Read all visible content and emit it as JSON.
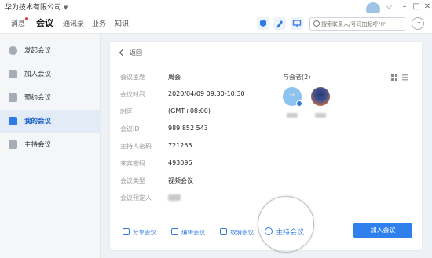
{
  "window": {
    "company": "华为技术有限公司",
    "avatar_text": "(blurred)"
  },
  "nav": {
    "tabs": [
      {
        "label": "消息",
        "active": false,
        "badge": true
      },
      {
        "label": "会议",
        "active": true
      },
      {
        "label": "通讯录",
        "active": false
      },
      {
        "label": "业务",
        "active": false
      },
      {
        "label": "知识",
        "active": false
      }
    ],
    "search_placeholder": "搜索联系人/号码加起呼\"0\""
  },
  "sidebar": {
    "items": [
      {
        "label": "发起会议",
        "icon": "phone-icon",
        "active": false
      },
      {
        "label": "加入会议",
        "icon": "join-icon",
        "active": false
      },
      {
        "label": "预约会议",
        "icon": "calendar-icon",
        "active": false
      },
      {
        "label": "我的会议",
        "icon": "my-meetings-icon",
        "active": true
      },
      {
        "label": "主持会议",
        "icon": "host-icon",
        "active": false
      }
    ]
  },
  "detail": {
    "back_label": "返回",
    "fields": [
      {
        "key": "会议主题",
        "value": "周会"
      },
      {
        "key": "会议时间",
        "value": "2020/04/09 09:30-10:30"
      },
      {
        "key": "时区",
        "value": "(GMT+08:00)"
      },
      {
        "key": "会议ID",
        "value": "989 852 543"
      },
      {
        "key": "主持人密码",
        "value": "721255"
      },
      {
        "key": "来宾密码",
        "value": "493096"
      },
      {
        "key": "会议类型",
        "value": "视频会议"
      },
      {
        "key": "会议预定人",
        "value": ""
      }
    ],
    "attendees_title": "与会者(2)"
  },
  "actions": {
    "share": "分享会议",
    "edit": "编辑会议",
    "cancel": "取消会议",
    "host": "主持会议",
    "join": "加入会议"
  },
  "colors": {
    "accent": "#2f80ed",
    "sidebar_active": "#e3ebf7",
    "badge": "#e53935"
  }
}
